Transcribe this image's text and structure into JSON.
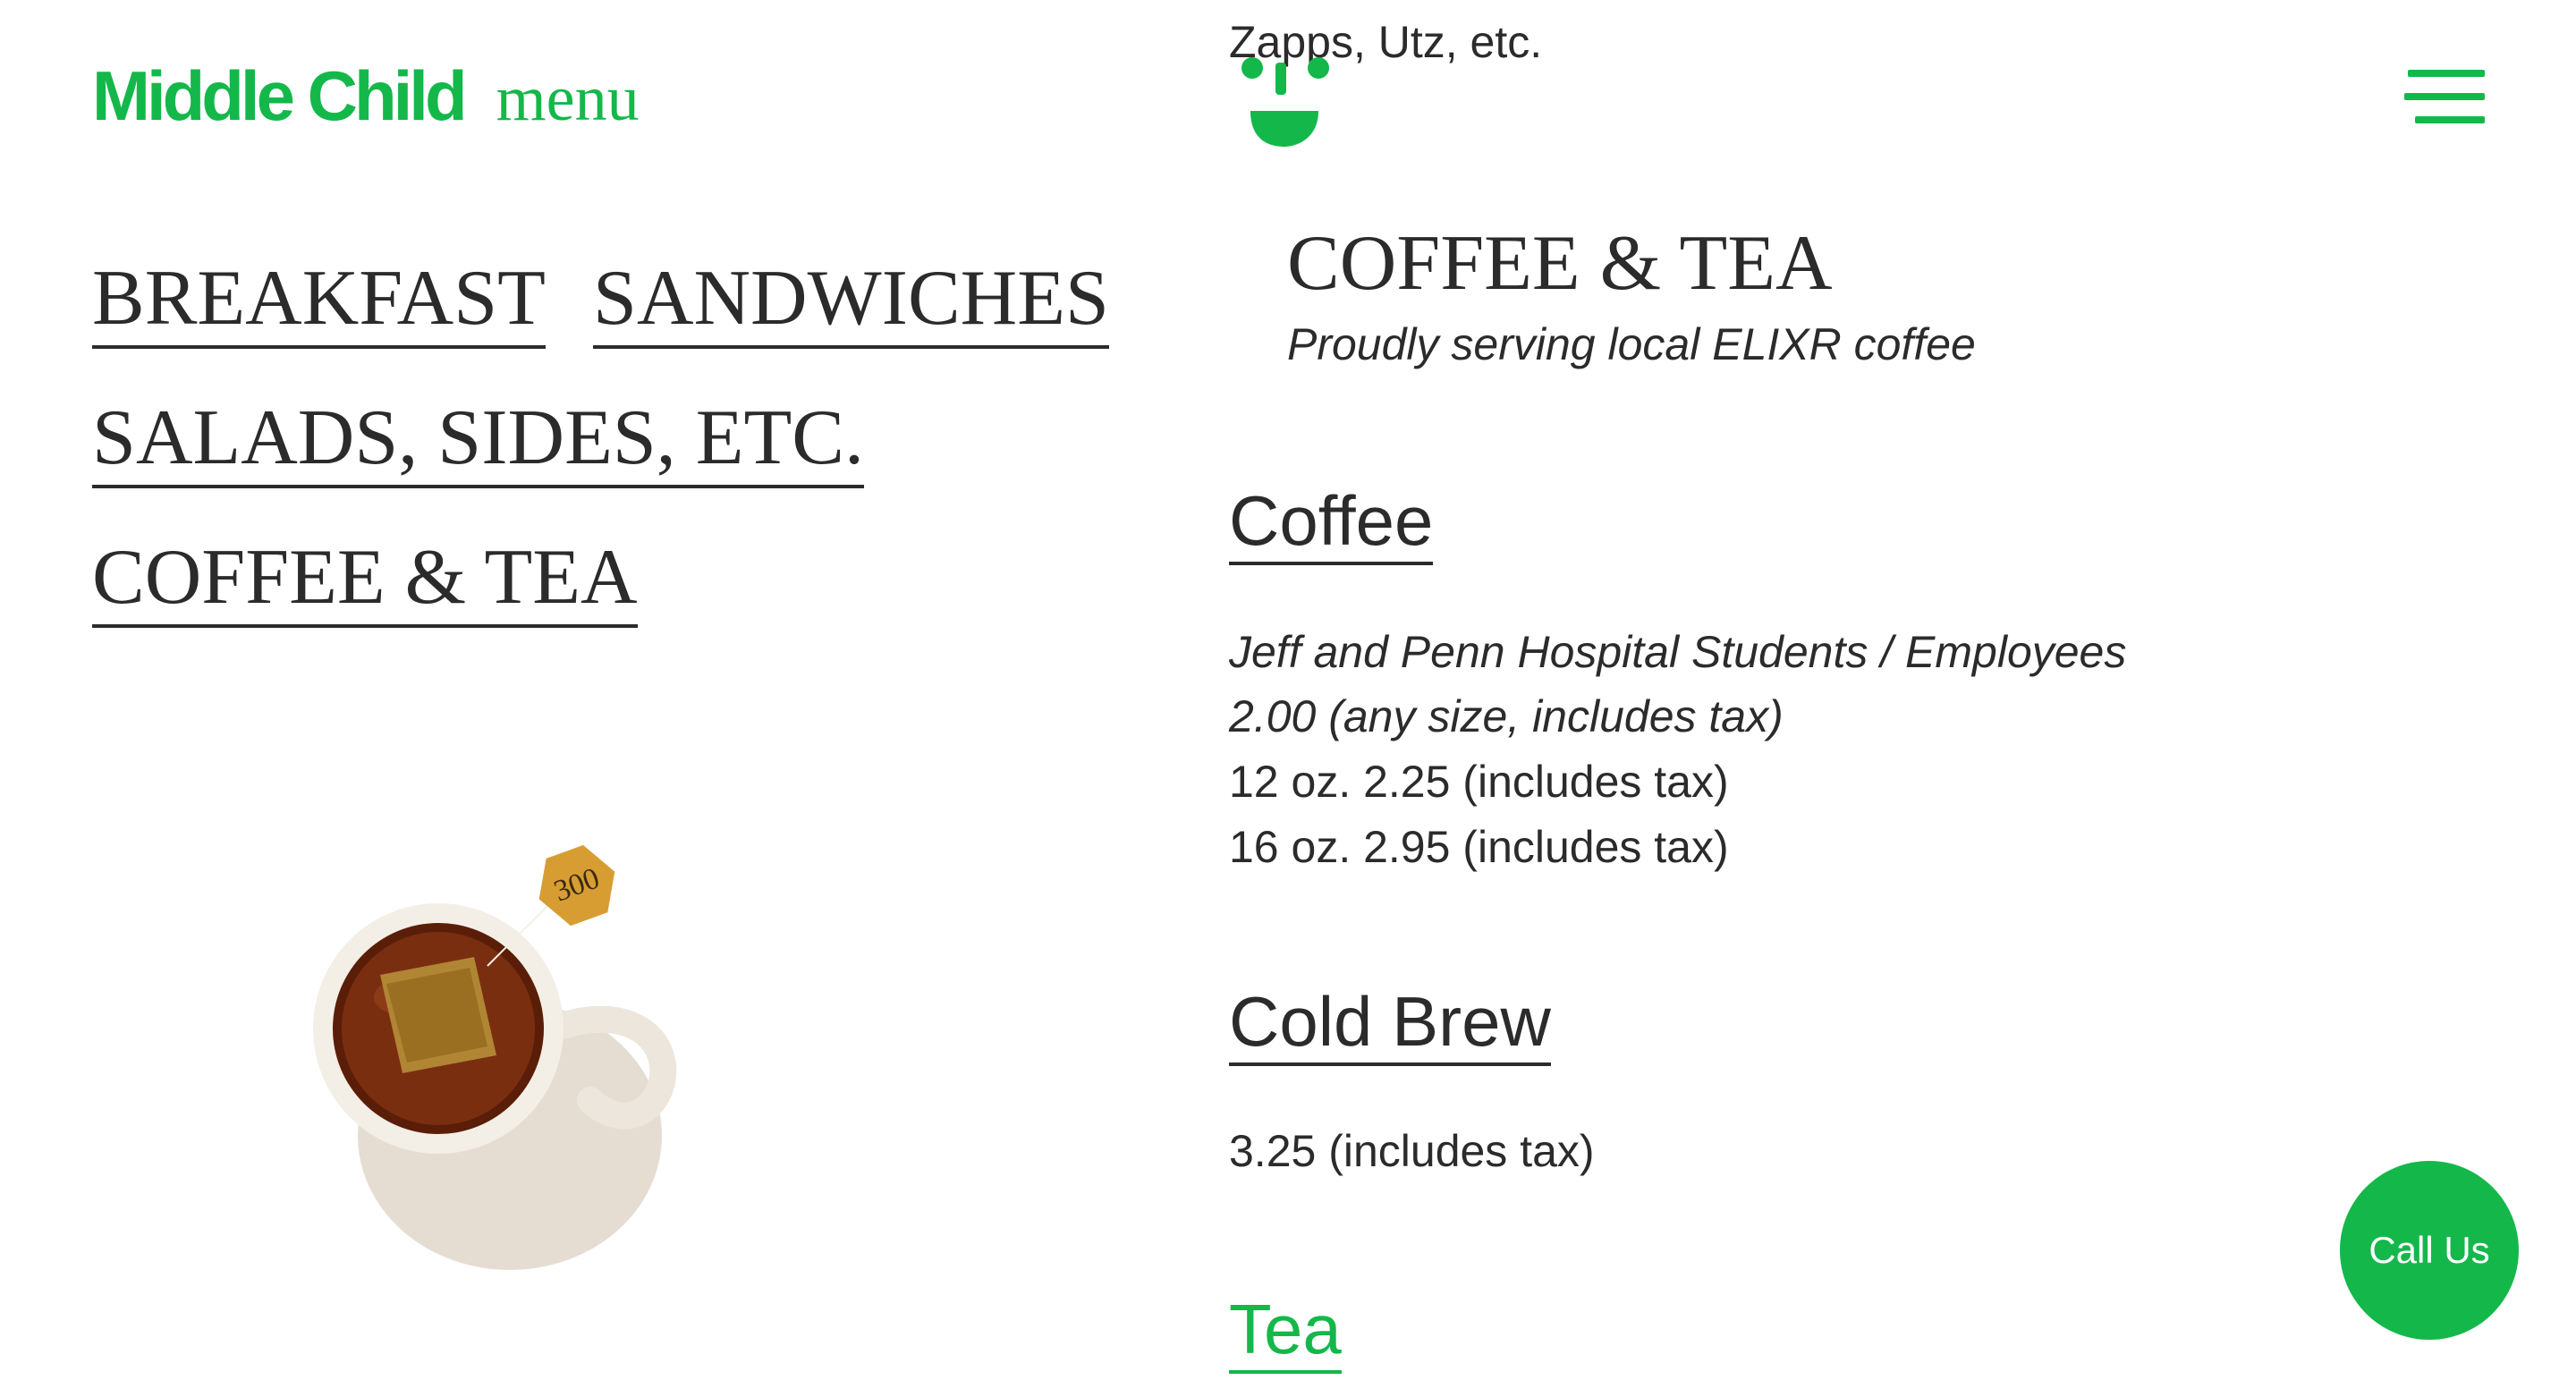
{
  "brand": {
    "name": "Middle Child",
    "subtitle": "menu"
  },
  "categories": [
    {
      "label": "BREAKFAST"
    },
    {
      "label": "SANDWICHES"
    },
    {
      "label": "SALADS, SIDES, ETC."
    },
    {
      "label": "COFFEE & TEA"
    }
  ],
  "scroll_text": "Zapps, Utz, etc.",
  "section": {
    "title": "COFFEE & TEA",
    "subtitle": "Proudly serving local ELIXR coffee"
  },
  "items": [
    {
      "name": "Coffee",
      "lines": [
        "Jeff and Penn Hospital Students / Employees",
        "2.00 (any size, includes tax)",
        "12 oz. 2.25 (includes tax)",
        "16 oz. 2.95 (includes tax)"
      ]
    },
    {
      "name": "Cold Brew",
      "lines": [
        "3.25 (includes tax)"
      ]
    },
    {
      "name": "Tea"
    }
  ],
  "call_button": {
    "label": "Call Us"
  },
  "icons": {
    "menu": "hamburger-menu-icon",
    "logo": "smiley-face-logo-icon"
  },
  "colors": {
    "brand_green": "#14b84a",
    "text": "#2b2b2b",
    "background": "#ffffff"
  }
}
